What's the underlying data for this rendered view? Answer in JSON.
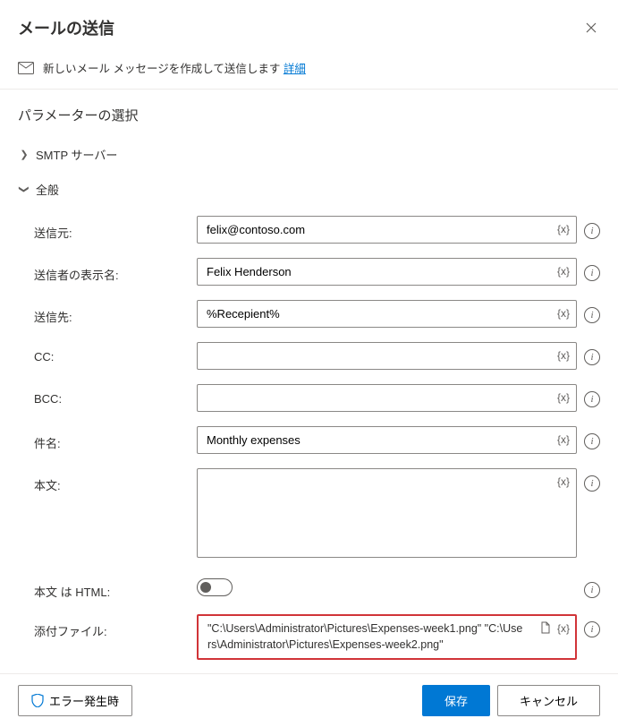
{
  "header": {
    "title": "メールの送信"
  },
  "banner": {
    "text": "新しいメール メッセージを作成して送信します ",
    "link": "詳細"
  },
  "section_title": "パラメーターの選択",
  "groups": {
    "smtp": {
      "label": "SMTP サーバー"
    },
    "general": {
      "label": "全般"
    }
  },
  "fields": {
    "from": {
      "label": "送信元:",
      "value": "felix@contoso.com"
    },
    "displayName": {
      "label": "送信者の表示名:",
      "value": "Felix Henderson"
    },
    "to": {
      "label": "送信先:",
      "value": "%Recepient%"
    },
    "cc": {
      "label": "CC:",
      "value": ""
    },
    "bcc": {
      "label": "BCC:",
      "value": ""
    },
    "subject": {
      "label": "件名:",
      "value": "Monthly expenses"
    },
    "body": {
      "label": "本文:",
      "value": ""
    },
    "isHtml": {
      "label": "本文 は HTML:"
    },
    "attach": {
      "label": "添付ファイル:",
      "value": "\"C:\\Users\\Administrator\\Pictures\\Expenses-week1.png\" \"C:\\Users\\Administrator\\Pictures\\Expenses-week2.png\""
    }
  },
  "var_badge": "{x}",
  "footer": {
    "error": "エラー発生時",
    "save": "保存",
    "cancel": "キャンセル"
  }
}
